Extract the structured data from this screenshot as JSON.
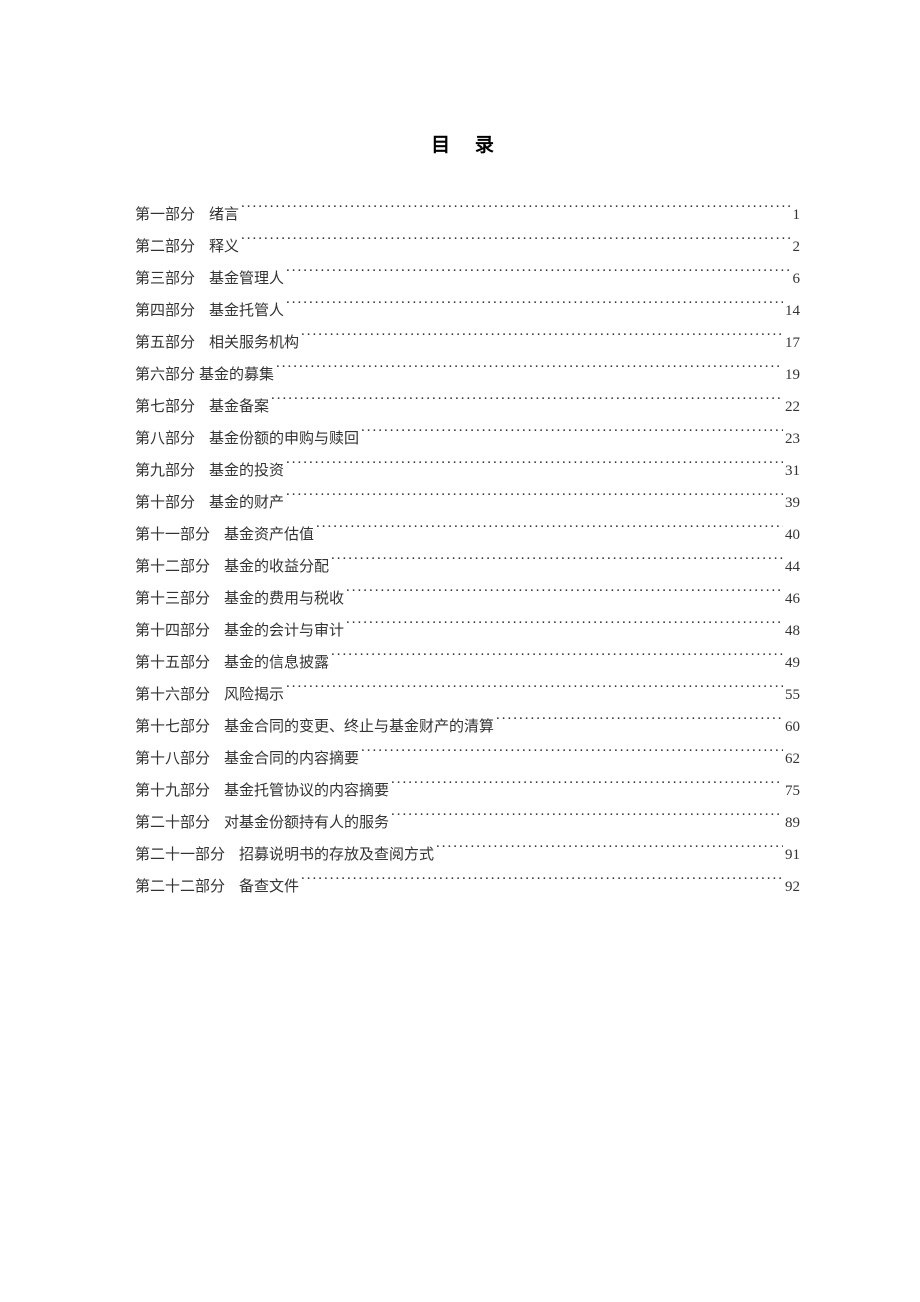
{
  "title": "目 录",
  "toc": [
    {
      "part": "第一部分",
      "gap": 14,
      "chapter": "绪言",
      "page": "1"
    },
    {
      "part": "第二部分",
      "gap": 14,
      "chapter": "释义",
      "page": "2"
    },
    {
      "part": "第三部分",
      "gap": 14,
      "chapter": "基金管理人",
      "page": "6"
    },
    {
      "part": "第四部分",
      "gap": 14,
      "chapter": "基金托管人",
      "page": "14"
    },
    {
      "part": "第五部分",
      "gap": 14,
      "chapter": "相关服务机构",
      "page": "17"
    },
    {
      "part": "第六部分",
      "gap": 4,
      "chapter": "基金的募集",
      "page": "19"
    },
    {
      "part": "第七部分",
      "gap": 14,
      "chapter": "基金备案",
      "page": "22"
    },
    {
      "part": "第八部分",
      "gap": 14,
      "chapter": "基金份额的申购与赎回",
      "page": "23"
    },
    {
      "part": "第九部分",
      "gap": 14,
      "chapter": "基金的投资",
      "page": "31"
    },
    {
      "part": "第十部分",
      "gap": 14,
      "chapter": "基金的财产",
      "page": "39"
    },
    {
      "part": "第十一部分",
      "gap": 14,
      "chapter": "基金资产估值",
      "page": "40"
    },
    {
      "part": "第十二部分",
      "gap": 14,
      "chapter": "基金的收益分配",
      "page": "44"
    },
    {
      "part": "第十三部分",
      "gap": 14,
      "chapter": "基金的费用与税收",
      "page": "46"
    },
    {
      "part": "第十四部分",
      "gap": 14,
      "chapter": "基金的会计与审计",
      "page": "48"
    },
    {
      "part": "第十五部分",
      "gap": 14,
      "chapter": "基金的信息披露",
      "page": "49"
    },
    {
      "part": "第十六部分",
      "gap": 14,
      "chapter": "风险揭示",
      "page": "55"
    },
    {
      "part": "第十七部分",
      "gap": 14,
      "chapter": "基金合同的变更、终止与基金财产的清算",
      "page": "60"
    },
    {
      "part": "第十八部分",
      "gap": 14,
      "chapter": "基金合同的内容摘要",
      "page": "62"
    },
    {
      "part": "第十九部分",
      "gap": 14,
      "chapter": "基金托管协议的内容摘要",
      "page": "75"
    },
    {
      "part": "第二十部分",
      "gap": 14,
      "chapter": "对基金份额持有人的服务",
      "page": "89"
    },
    {
      "part": "第二十一部分",
      "gap": 14,
      "chapter": "招募说明书的存放及查阅方式",
      "page": "91"
    },
    {
      "part": "第二十二部分",
      "gap": 14,
      "chapter": "备查文件",
      "page": "92"
    }
  ]
}
